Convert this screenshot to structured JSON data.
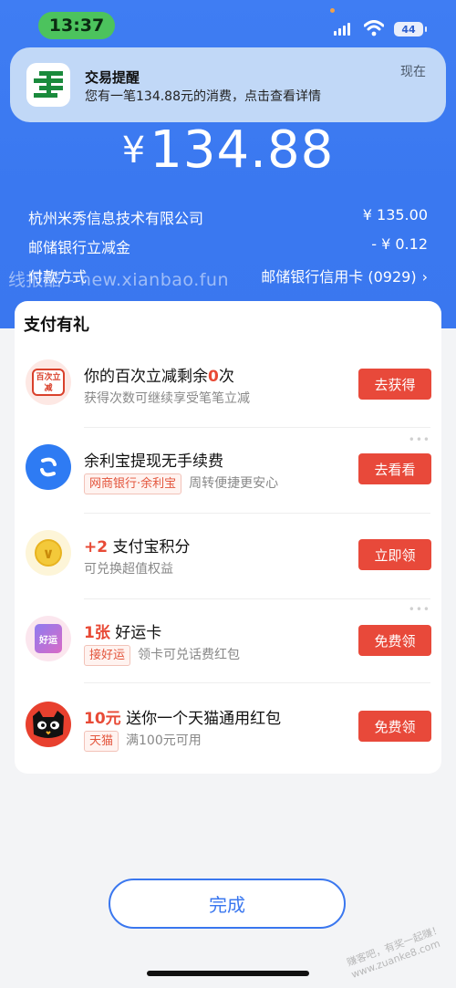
{
  "status_bar": {
    "time": "13:37",
    "battery": "44"
  },
  "notification": {
    "title": "交易提醒",
    "body": "您有一笔134.88元的消费，点击查看详情",
    "time": "现在",
    "app_icon": "postal-savings-bank-icon"
  },
  "payment": {
    "currency_symbol": "¥",
    "amount": "134.88",
    "merchant": "杭州米秀信息技术有限公司",
    "merchant_amount": "¥ 135.00",
    "discount_label": "邮储银行立减金",
    "discount_amount": "- ¥ 0.12",
    "method_label": "付款方式",
    "method_value": "邮储银行信用卡 (0929)"
  },
  "watermark": "线报酷 - new.xianbao.fun",
  "rewards": {
    "title": "支付有礼",
    "items": [
      {
        "icon": "baici-lijian-icon",
        "icon_text": "百次立减",
        "highlight": "",
        "title_pre": "你的百次立减剩余",
        "title_hl": "0",
        "title_post": "次",
        "subtitle": "获得次数可继续享受笔笔立减",
        "tag": "",
        "button": "去获得"
      },
      {
        "icon": "yulibao-icon",
        "highlight": "",
        "title_pre": "余利宝提现无手续费",
        "title_hl": "",
        "title_post": "",
        "subtitle": "周转便捷更安心",
        "tag": "网商银行·余利宝",
        "button": "去看看"
      },
      {
        "icon": "alipay-points-icon",
        "highlight": "+2",
        "title_pre": "支付宝积分",
        "title_hl": "",
        "title_post": "",
        "subtitle": "可兑换超值权益",
        "tag": "",
        "button": "立即领"
      },
      {
        "icon": "lucky-card-icon",
        "icon_text": "好运",
        "highlight": "1张",
        "title_pre": "好运卡",
        "title_hl": "",
        "title_post": "",
        "subtitle": "领卡可兑话费红包",
        "tag": "接好运",
        "button": "免费领"
      },
      {
        "icon": "tmall-cat-icon",
        "highlight": "10元",
        "title_pre": "送你一个天猫通用红包",
        "title_hl": "",
        "title_post": "",
        "subtitle": "满100元可用",
        "tag": "天猫",
        "button": "免费领"
      }
    ]
  },
  "done_button": "完成",
  "corner_watermark": {
    "line1": "赚客吧，有奖一起赚！",
    "line2": "www.zuanke8.com"
  },
  "colors": {
    "primary_blue": "#3a77ef",
    "button_red": "#e8493a",
    "highlight_red": "#e84a36",
    "time_pill_green": "#4cc35d"
  }
}
